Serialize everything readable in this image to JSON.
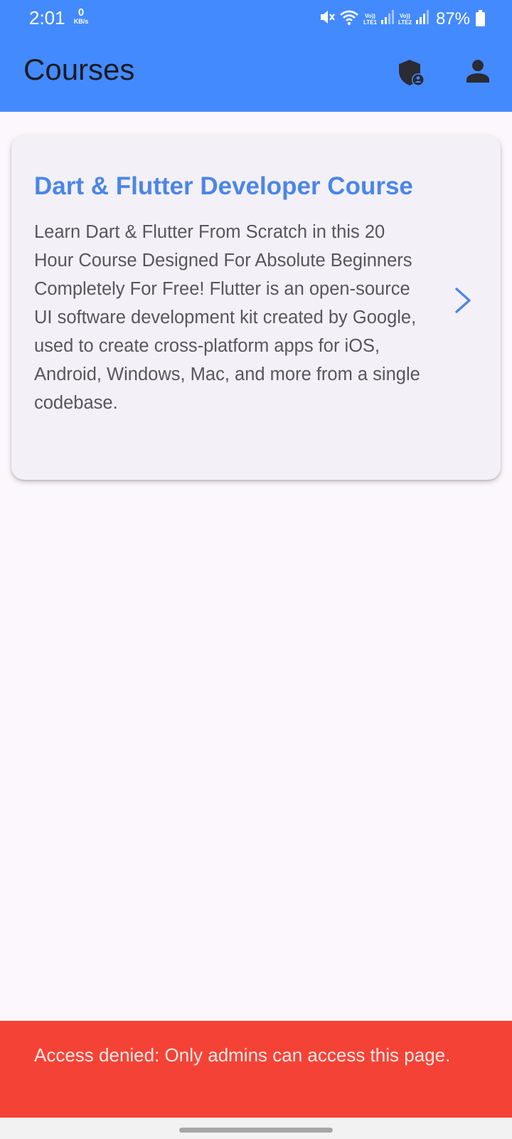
{
  "status_bar": {
    "time": "2:01",
    "net_speed_value": "0",
    "net_speed_unit": "KB/s",
    "sim1_label": "LTE1",
    "sim2_label": "LTE2",
    "volte_label": "Vo))",
    "battery_percent": "87%",
    "icons": [
      "mute-icon",
      "wifi-icon",
      "signal-icon",
      "signal-icon",
      "battery-icon"
    ]
  },
  "app_bar": {
    "title": "Courses",
    "actions": [
      {
        "icon": "admin-shield-icon"
      },
      {
        "icon": "profile-person-icon"
      }
    ],
    "color": "#448aff"
  },
  "courses": [
    {
      "title": "Dart & Flutter Developer Course",
      "description": "Learn Dart & Flutter From Scratch in this 20 Hour Course Designed For Absolute Beginners  Completely For Free! Flutter is an open-source UI software development kit created by Google, used to create cross-platform apps for iOS, Android, Windows, Mac, and more from a single codebase.",
      "icon": "chevron-right-icon"
    }
  ],
  "snackbar": {
    "message": "Access denied: Only admins can access this page.",
    "color": "#f44336"
  },
  "colors": {
    "accent": "#4a86e8",
    "background": "#fcf7fd",
    "card": "#f4f0f7"
  }
}
